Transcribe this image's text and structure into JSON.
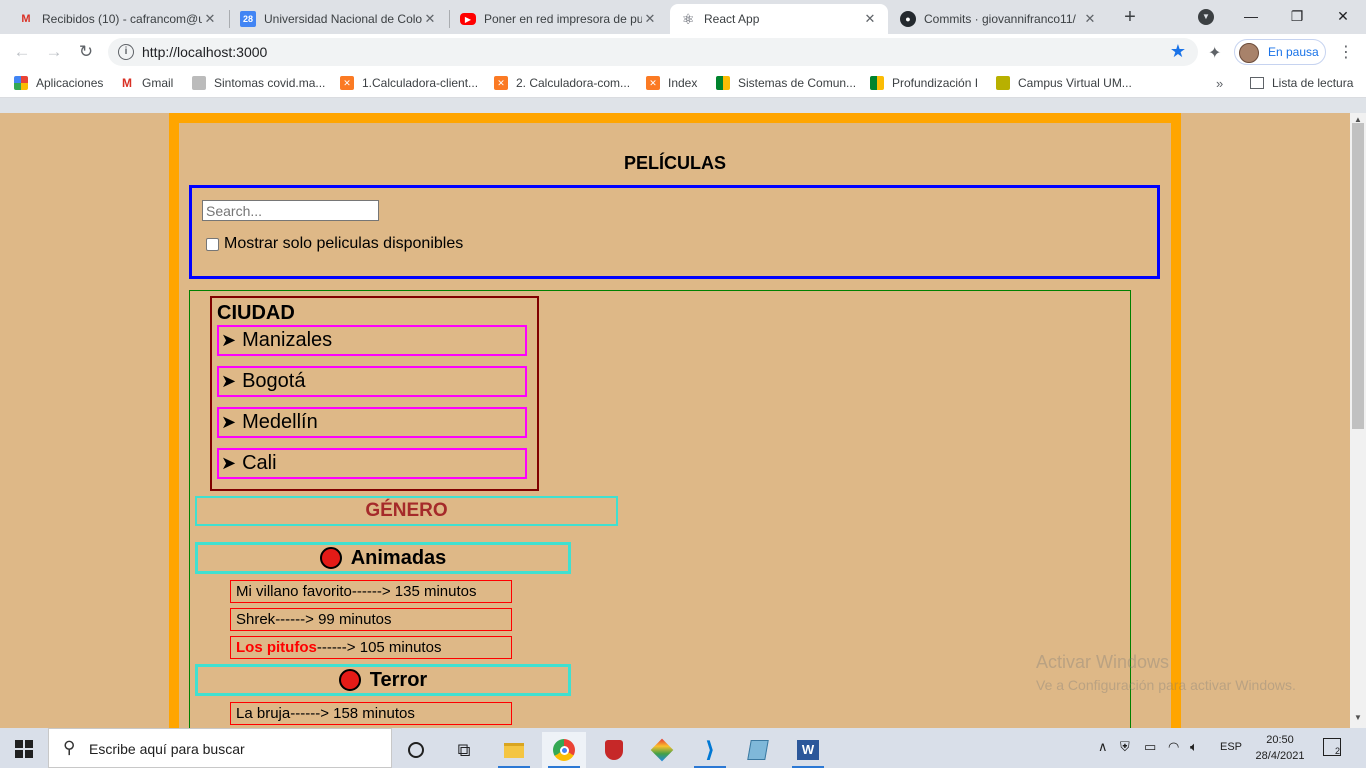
{
  "browser": {
    "tabs": [
      {
        "title": "Recibidos (10) - cafrancom@u",
        "icon": "gmail-icon",
        "active": false
      },
      {
        "title": "Universidad Nacional de Colo",
        "icon": "calendar-icon",
        "active": false
      },
      {
        "title": "Poner en red impresora de pu",
        "icon": "youtube-icon",
        "active": false
      },
      {
        "title": "React App",
        "icon": "react-icon",
        "active": true
      },
      {
        "title": "Commits · giovannifranco11/",
        "icon": "github-icon",
        "active": false
      }
    ],
    "address": "http://localhost:3000",
    "profile_label": "En pausa",
    "bookmarks": [
      {
        "label": "Aplicaciones",
        "icon": "apps-grid-icon"
      },
      {
        "label": "Gmail",
        "icon": "gmail-icon"
      },
      {
        "label": "Sintomas covid.ma...",
        "icon": "page-icon"
      },
      {
        "label": "1.Calculadora-client...",
        "icon": "xampp-icon"
      },
      {
        "label": "2. Calculadora-com...",
        "icon": "xampp-icon"
      },
      {
        "label": "Index",
        "icon": "xampp-icon"
      },
      {
        "label": "Sistemas de Comun...",
        "icon": "meet-icon"
      },
      {
        "label": "Profundización I",
        "icon": "meet-icon"
      },
      {
        "label": "Campus Virtual UM...",
        "icon": "moodle-icon"
      }
    ],
    "reading_list": "Lista de lectura"
  },
  "app": {
    "title": "PELÍCULAS",
    "search": {
      "placeholder": "Search...",
      "value": ""
    },
    "only_available_label": "Mostrar solo peliculas disponibles",
    "only_available_checked": false,
    "city_heading": "CIUDAD",
    "cities": [
      {
        "arrow": "➤",
        "name": "Manizales"
      },
      {
        "arrow": "➤",
        "name": "Bogotá"
      },
      {
        "arrow": "➤",
        "name": "Medellín"
      },
      {
        "arrow": "➤",
        "name": "Cali"
      }
    ],
    "genre_heading": "GÉNERO",
    "genres": [
      {
        "name": "Animadas",
        "movies": [
          {
            "title": "Mi villano favorito",
            "suffix": "------> 135 minutos",
            "available": true
          },
          {
            "title": "Shrek",
            "suffix": "------> 99 minutos",
            "available": true
          },
          {
            "title": "Los pitufos",
            "suffix": "------> 105 minutos",
            "available": false
          }
        ]
      },
      {
        "name": "Terror",
        "movies": [
          {
            "title": "La bruja",
            "suffix": "------> 158 minutos",
            "available": true
          }
        ]
      }
    ]
  },
  "watermark": {
    "line1": "Activar Windows",
    "line2": "Ve a Configuración para activar Windows."
  },
  "taskbar": {
    "search_placeholder": "Escribe aquí para buscar",
    "language": "ESP",
    "time": "20:50",
    "date": "28/4/2021",
    "notifications": "2"
  },
  "colors": {
    "page_background": "#deb887",
    "app_border": "#ffa500",
    "search_border": "#0000ff",
    "city_border": "#800000",
    "city_item_border": "#ff00ff",
    "genre_border": "#40e0d0",
    "genre_heading_text": "#a52a2a",
    "movie_border": "#ff0000",
    "unavailable_text": "#ff0000",
    "genre_dot": "#e41b17"
  }
}
